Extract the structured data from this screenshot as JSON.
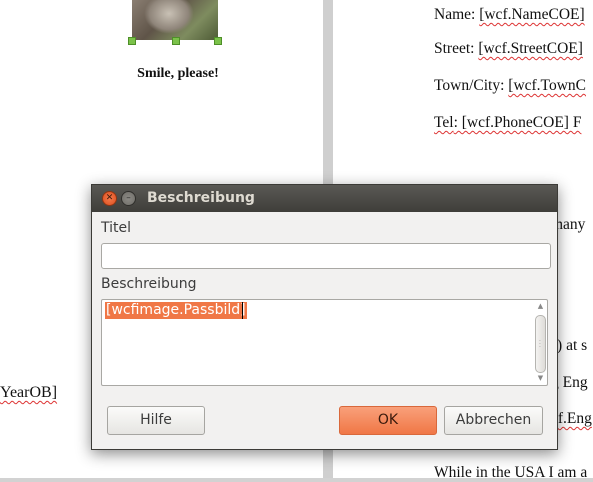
{
  "document": {
    "caption": "Smile, please!",
    "left_partial_text": "YearOB]",
    "lines": [
      {
        "prefix": "Name: ",
        "field": "[wcf.NameCOE]"
      },
      {
        "prefix": "Street: ",
        "field": "[wcf.StreetCOE]"
      },
      {
        "prefix": "Town/City: ",
        "field": "[wcf.TownC"
      },
      {
        "prefix": "Tel",
        "field": ": [wcf.PhoneCOE]  F"
      }
    ],
    "fragments": {
      "many": "many",
      "at": "s) at s",
      "eng": "g Eng",
      "cf_eng": "cf.Eng",
      "while": "While in the USA I am a"
    }
  },
  "dialog": {
    "title": "Beschreibung",
    "titel_label": "Titel",
    "titel_value": "",
    "beschreibung_label": "Beschreibung",
    "beschreibung_value": "[wcfimage.Passbild]",
    "buttons": {
      "help": "Hilfe",
      "ok": "OK",
      "cancel": "Abbrechen"
    }
  },
  "colors": {
    "selection": "#f07746",
    "ok_button": "#f07746",
    "titlebar": "#3f3e3a"
  }
}
